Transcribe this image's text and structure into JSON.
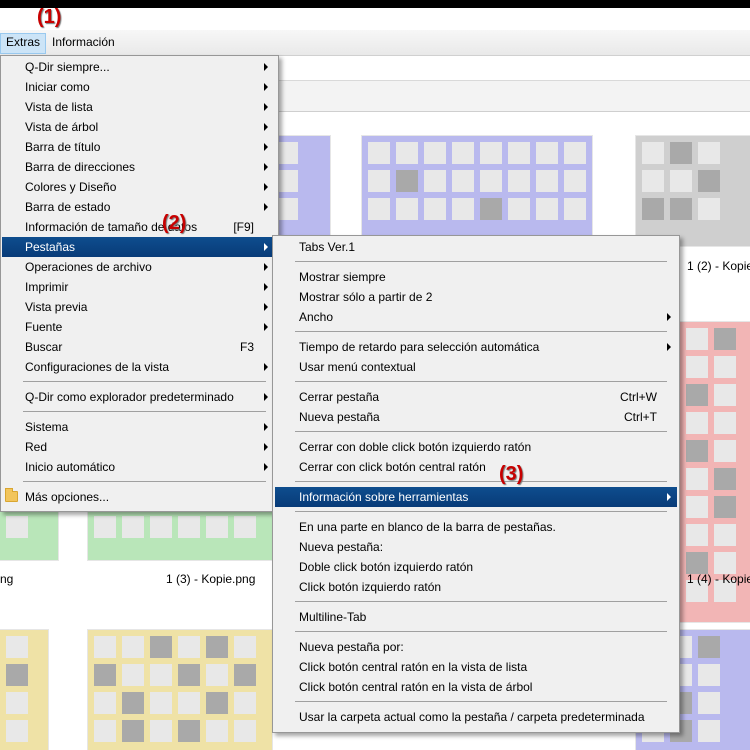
{
  "annotations": [
    "(1)",
    "(2)",
    "(3)"
  ],
  "menubar": {
    "items": [
      "Extras",
      "Información"
    ]
  },
  "files": [
    "1 (2) - Kopie",
    "1 (3) - Kopie.png",
    "1 (4) - Kopie",
    "ng"
  ],
  "colors": {
    "highlight": "#0a4585",
    "menu_bg": "#f0f0f0",
    "annotation": "#c80000"
  },
  "extras_menu": {
    "items": [
      {
        "label": "Q-Dir siempre...",
        "arrow": true
      },
      {
        "label": "Iniciar como",
        "arrow": true
      },
      {
        "label": "Vista de lista",
        "arrow": true
      },
      {
        "label": "Vista de árbol",
        "arrow": true
      },
      {
        "label": "Barra de título",
        "arrow": true
      },
      {
        "label": "Barra de direcciones",
        "arrow": true
      },
      {
        "label": "Colores y Diseño",
        "arrow": true
      },
      {
        "label": "Barra de estado",
        "arrow": true
      },
      {
        "label": "Información de tamaño de datos",
        "shortcut": "[F9]"
      },
      {
        "label": "Pestañas",
        "arrow": true,
        "highlight": true
      },
      {
        "label": "Operaciones de archivo",
        "arrow": true
      },
      {
        "label": "Imprimir",
        "arrow": true
      },
      {
        "label": "Vista previa",
        "arrow": true
      },
      {
        "label": "Fuente",
        "arrow": true
      },
      {
        "label": "Buscar",
        "shortcut": "F3"
      },
      {
        "label": "Configuraciones de la vista",
        "arrow": true
      },
      {
        "separator": true
      },
      {
        "label": "Q-Dir como explorador predeterminado",
        "arrow": true
      },
      {
        "separator": true
      },
      {
        "label": "Sistema",
        "arrow": true
      },
      {
        "label": "Red",
        "arrow": true
      },
      {
        "label": "Inicio automático",
        "arrow": true
      },
      {
        "separator": true
      },
      {
        "label": "Más opciones...",
        "icon": "folder-icon"
      }
    ]
  },
  "tabs_menu": {
    "items": [
      {
        "label": "Tabs Ver.1"
      },
      {
        "separator": true
      },
      {
        "label": "Mostrar siempre"
      },
      {
        "label": "Mostrar sólo a partir de 2"
      },
      {
        "label": "Ancho",
        "arrow": true
      },
      {
        "separator": true
      },
      {
        "label": "Tiempo de retardo para selección automática",
        "arrow": true
      },
      {
        "label": "Usar menú contextual"
      },
      {
        "separator": true
      },
      {
        "label": "Cerrar pestaña",
        "shortcut": "Ctrl+W"
      },
      {
        "label": "Nueva pestaña",
        "shortcut": "Ctrl+T"
      },
      {
        "separator": true
      },
      {
        "label": "Cerrar con doble click botón izquierdo ratón"
      },
      {
        "label": "Cerrar con click botón central ratón"
      },
      {
        "separator": true
      },
      {
        "label": "Información sobre herramientas",
        "arrow": true,
        "highlight": true
      },
      {
        "separator": true
      },
      {
        "label": "En una parte en blanco de la barra de pestañas."
      },
      {
        "label": "Nueva pestaña:"
      },
      {
        "label": "Doble click botón izquierdo ratón"
      },
      {
        "label": "Click botón izquierdo ratón"
      },
      {
        "separator": true
      },
      {
        "label": "Multiline-Tab"
      },
      {
        "separator": true
      },
      {
        "label": "Nueva pestaña por:"
      },
      {
        "label": "Click botón central ratón en la vista de lista"
      },
      {
        "label": "Click botón central ratón en la vista de árbol"
      },
      {
        "separator": true
      },
      {
        "label": "Usar la carpeta actual como la pestaña / carpeta predeterminada"
      }
    ]
  }
}
